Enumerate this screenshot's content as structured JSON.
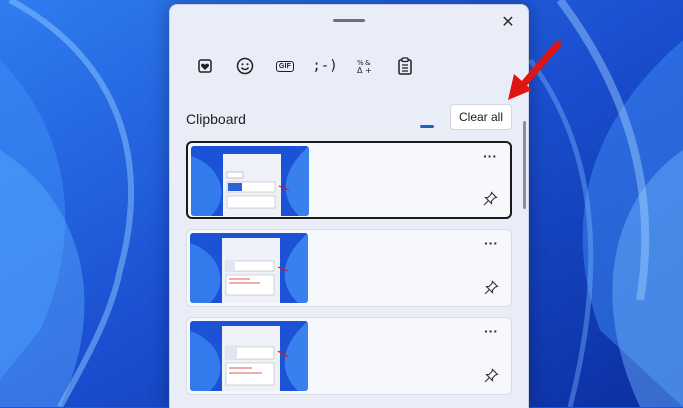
{
  "colors": {
    "accent": "#1f5fc7",
    "arrow": "#e01414",
    "wallpaper": "#1d57d8"
  },
  "panel": {
    "close_icon": "✕",
    "tabs": [
      {
        "name": "emoji-favorite-icon",
        "glyph": "♥"
      },
      {
        "name": "emoji-icon",
        "glyph": "☺"
      },
      {
        "name": "gif-icon",
        "glyph": "GIF"
      },
      {
        "name": "kaomoji-icon",
        "glyph": ";-)"
      },
      {
        "name": "symbols-icon",
        "glyph": "%&"
      },
      {
        "name": "clipboard-icon",
        "glyph": "clipboard",
        "active": true
      }
    ],
    "section_title": "Clipboard",
    "clear_all_label": "Clear all",
    "more_label": "···"
  },
  "clipboard_items": [
    {
      "kind": "screenshot",
      "selected": true
    },
    {
      "kind": "screenshot",
      "selected": false
    },
    {
      "kind": "screenshot",
      "selected": false
    }
  ]
}
